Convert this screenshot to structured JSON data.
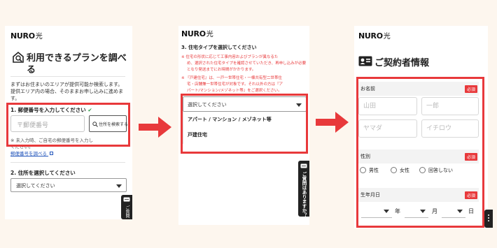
{
  "brand": {
    "name": "NURO",
    "kanji": "光"
  },
  "panel1": {
    "title_line1": "利用できるプランを調べ",
    "title_line2": "る",
    "intro_line1": "まずはお住まいのエリアが提供可能か検索します。",
    "intro_line2": "提供エリア内の場合、そのままお申し込みに進めま",
    "intro_line3": "す。",
    "step1_label": "1. 郵便番号を入力してください",
    "check_mark": "✔",
    "postal_placeholder": "〒郵便番号",
    "search_button": "住所を検索する",
    "note_line1": "※ 未入力時、ご自宅の郵便番号を入力し",
    "note_line2": "ください。",
    "postal_lookup_link": "郵便番号を調べる",
    "step2_label": "2. 住所を選択してください",
    "address_select_value": "選択してください",
    "help_tab": "ご質問"
  },
  "panel2": {
    "heading": "3. 住宅タイプを選択してください",
    "note1_line1": "住宅の形状に応じて工事内容およびプランが異なるた",
    "note1_line2": "め、選択された住宅タイプを確認させていただき、再申し込みが必要",
    "note1_line3": "となり発送までにお時間がかかります。",
    "note2_line1": "『戸建住宅』は、一戸一世帯住宅・一棟共有型二世帯住",
    "note2_line2": "宅・店舗兼一世帯住宅が対象です。それ以外の方は『ア",
    "note2_line3": "パート/マンション/メゾネット等』をご選択ください。",
    "select_placeholder": "選択してください",
    "options": [
      "アパート / マンション / メゾネット等",
      "戸建住宅"
    ],
    "help_tab": "ご質問はありますか？"
  },
  "panel3": {
    "title": "ご契約者情報",
    "name_label": "お名前",
    "required": "必須",
    "last_name_placeholder": "山田",
    "first_name_placeholder": "一郎",
    "last_kana_placeholder": "ヤマダ",
    "first_kana_placeholder": "イチロウ",
    "gender_label": "性別",
    "gender_options": [
      "男性",
      "女性",
      "回答しない"
    ],
    "birthday_label": "生年月日",
    "year_unit": "年",
    "month_unit": "月",
    "day_unit": "日"
  },
  "colors": {
    "accent": "#e8393b",
    "background": "#fdf6ee"
  }
}
